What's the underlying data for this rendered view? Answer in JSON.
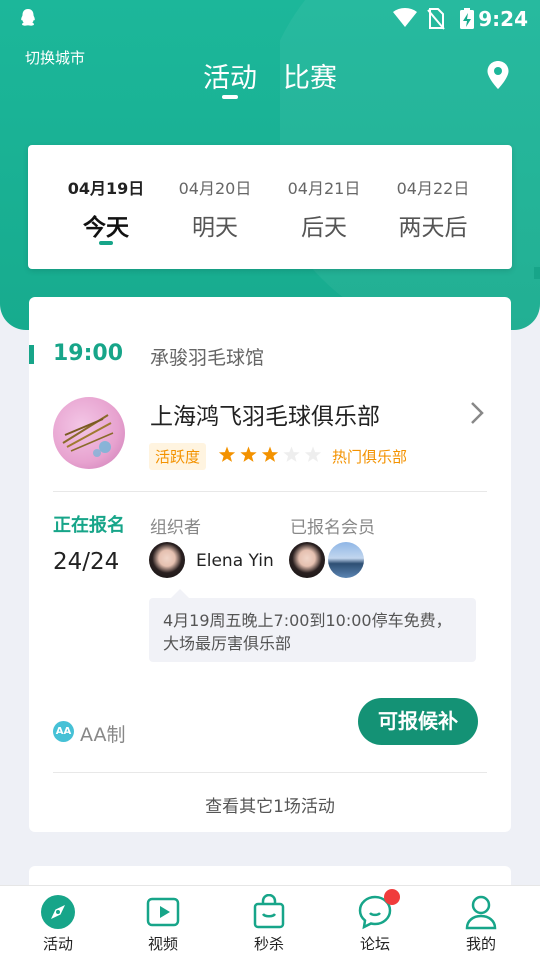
{
  "statusbar": {
    "time": "9:24"
  },
  "header": {
    "city_label": "切换城市",
    "tabs": [
      {
        "label": "活动"
      },
      {
        "label": "比赛"
      }
    ]
  },
  "dates": [
    {
      "date": "04月19日",
      "weekday": "今天"
    },
    {
      "date": "04月20日",
      "weekday": "明天"
    },
    {
      "date": "04月21日",
      "weekday": "后天"
    },
    {
      "date": "04月22日",
      "weekday": "两天后"
    }
  ],
  "event": {
    "time": "19:00",
    "venue": "承骏羽毛球馆",
    "club_name": "上海鸿飞羽毛球俱乐部",
    "activity_badge": "活跃度",
    "rating": 3,
    "rating_max": 5,
    "hot_label": "热门俱乐部",
    "status_label": "正在报名",
    "count": "24/24",
    "organizer_label": "组织者",
    "organizer_name": "Elena Yin",
    "members_label": "已报名会员",
    "note": "4月19周五晚上7:00到10:00停车免费，大场最厉害俱乐部",
    "aa_icon": "AA",
    "fee_type": "AA制",
    "join_button": "可报候补",
    "more_link": "查看其它1场活动"
  },
  "tabbar": [
    {
      "label": "活动",
      "icon": "compass-icon"
    },
    {
      "label": "视频",
      "icon": "play-icon"
    },
    {
      "label": "秒杀",
      "icon": "shopping-bag-icon"
    },
    {
      "label": "论坛",
      "icon": "chat-bubble-icon"
    },
    {
      "label": "我的",
      "icon": "user-icon"
    }
  ],
  "colors": {
    "primary": "#17a589",
    "header": "#1cb79a",
    "accent_orange": "#f39200",
    "button": "#149275"
  }
}
